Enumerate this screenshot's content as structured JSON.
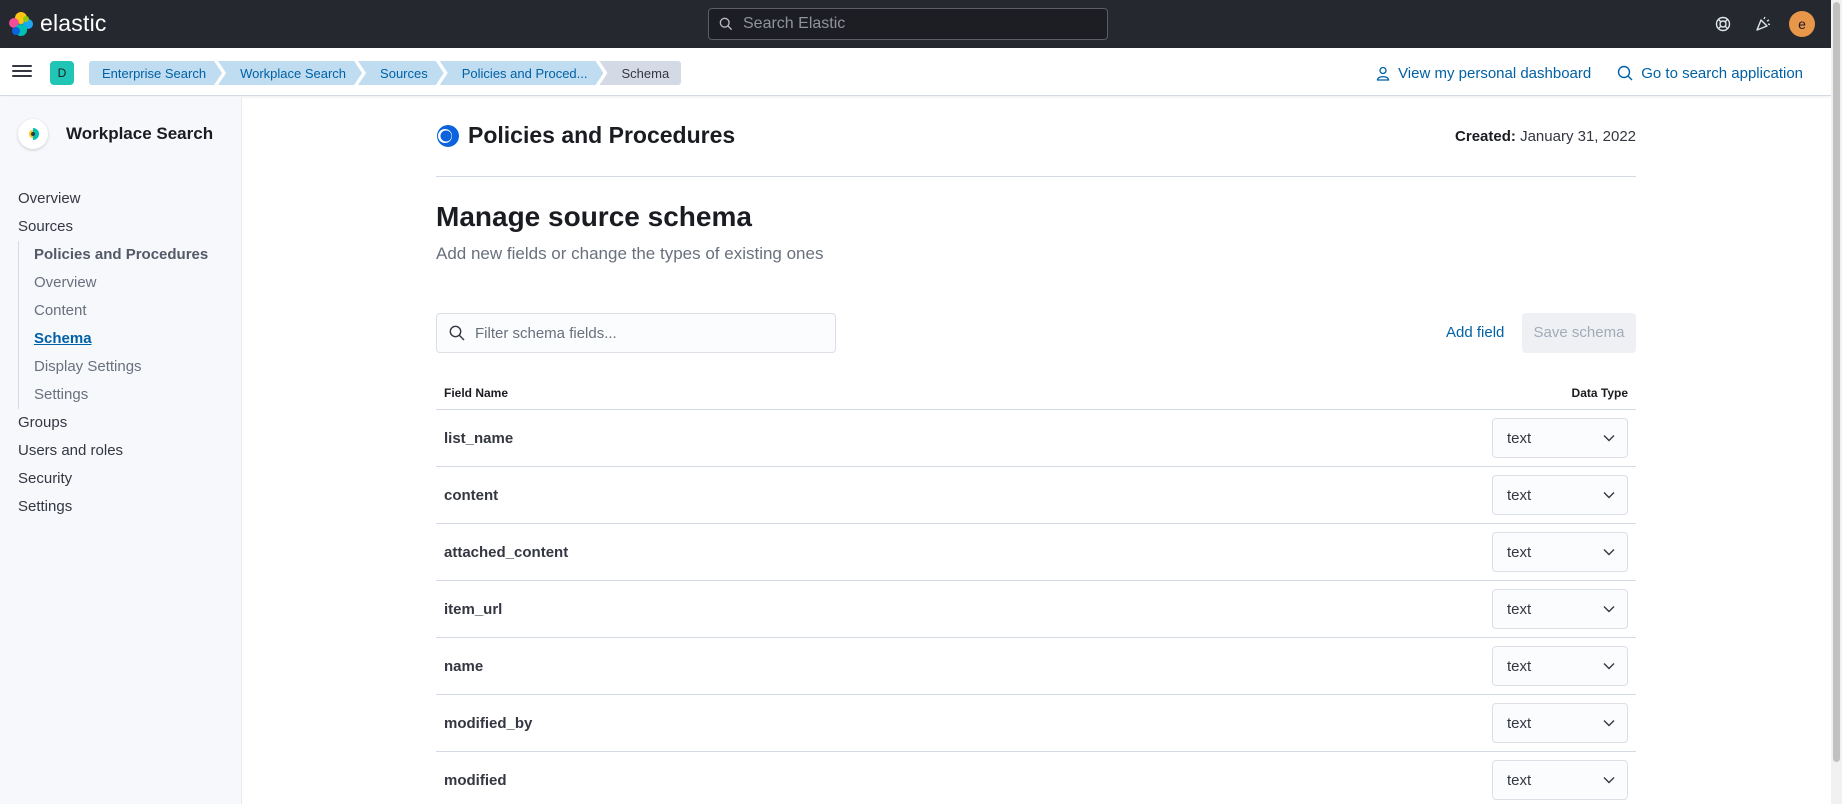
{
  "header": {
    "logo_text": "elastic",
    "search_placeholder": "Search Elastic",
    "icons": [
      "help-icon",
      "newsfeed-icon"
    ],
    "user_avatar": "e"
  },
  "breadcrumbs": {
    "space_badge": "D",
    "items": [
      "Enterprise Search",
      "Workplace Search",
      "Sources",
      "Policies and Proced...",
      "Schema"
    ],
    "links": {
      "dashboard": "View my personal dashboard",
      "search_app": "Go to search application"
    }
  },
  "sidebar": {
    "title": "Workplace Search",
    "items": {
      "overview": "Overview",
      "sources": "Sources",
      "source_name": "Policies and Procedures",
      "source_overview": "Overview",
      "content": "Content",
      "schema": "Schema",
      "display_settings": "Display Settings",
      "source_settings": "Settings",
      "groups": "Groups",
      "users_roles": "Users and roles",
      "security": "Security",
      "settings": "Settings"
    }
  },
  "page": {
    "title": "Policies and Procedures",
    "created_label": "Created:",
    "created_value": "January 31, 2022",
    "section_title": "Manage source schema",
    "section_subtitle": "Add new fields or change the types of existing ones",
    "filter_placeholder": "Filter schema fields...",
    "add_field": "Add field",
    "save_schema": "Save schema"
  },
  "table": {
    "col_field": "Field Name",
    "col_type": "Data Type",
    "rows": [
      {
        "name": "list_name",
        "type": "text"
      },
      {
        "name": "content",
        "type": "text"
      },
      {
        "name": "attached_content",
        "type": "text"
      },
      {
        "name": "item_url",
        "type": "text"
      },
      {
        "name": "name",
        "type": "text"
      },
      {
        "name": "modified_by",
        "type": "text"
      },
      {
        "name": "modified",
        "type": "text"
      }
    ]
  },
  "colors": {
    "header_bg": "#25282f",
    "link": "#0061a6",
    "crumb_bg": "#bfdcf0",
    "space_badge": "#20c5b6",
    "avatar": "#e7964a"
  }
}
